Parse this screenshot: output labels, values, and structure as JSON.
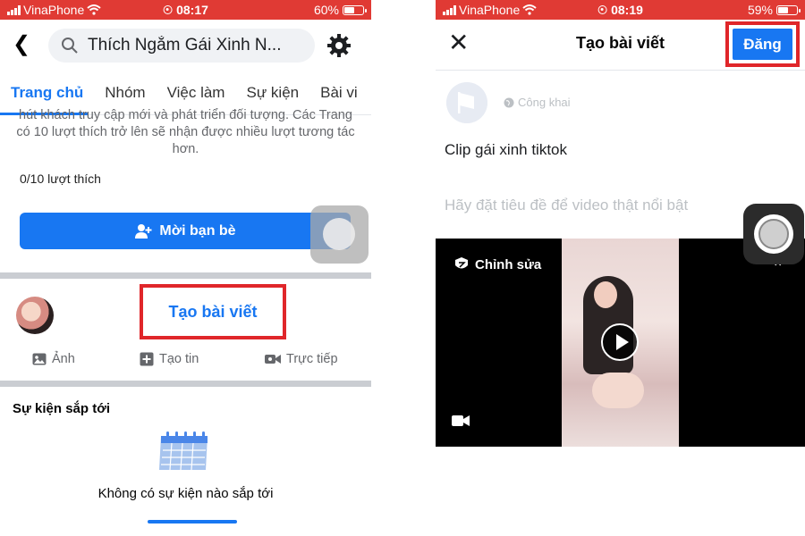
{
  "left_screen": {
    "status": {
      "carrier": "VinaPhone",
      "time": "08:17",
      "battery": "60%",
      "battery_level": 0.6
    },
    "header": {
      "page_title": "Thích Ngắm Gái Xinh N..."
    },
    "tabs": [
      "Trang chủ",
      "Nhóm",
      "Việc làm",
      "Sự kiện",
      "Bài vi"
    ],
    "help_text": "hút khách truy cập mới và phát triển đối tượng. Các Trang có 10 lượt thích trở lên sẽ nhận được nhiều lượt tương tác hơn.",
    "likes_progress": "0/10 lượt thích",
    "invite_button": "Mời bạn bè",
    "create_post": "Tạo bài viết",
    "actions": {
      "photo": "Ảnh",
      "story": "Tạo tin",
      "live": "Trực tiếp"
    },
    "events": {
      "title": "Sự kiện sắp tới",
      "empty": "Không có sự kiện nào sắp tới"
    }
  },
  "right_screen": {
    "status": {
      "carrier": "VinaPhone",
      "time": "08:19",
      "battery": "59%",
      "battery_level": 0.59
    },
    "header": {
      "title": "Tạo bài viết",
      "post_button": "Đăng"
    },
    "privacy": "Công khai",
    "caption": "Clip gái xinh tiktok",
    "video_title_placeholder": "Hãy đặt tiêu đề để video thật nổi bật",
    "edit_label": "Chỉnh sửa"
  },
  "colors": {
    "status_bar": "#e03a34",
    "brand_blue": "#1877f2",
    "highlight": "#e0262a"
  }
}
